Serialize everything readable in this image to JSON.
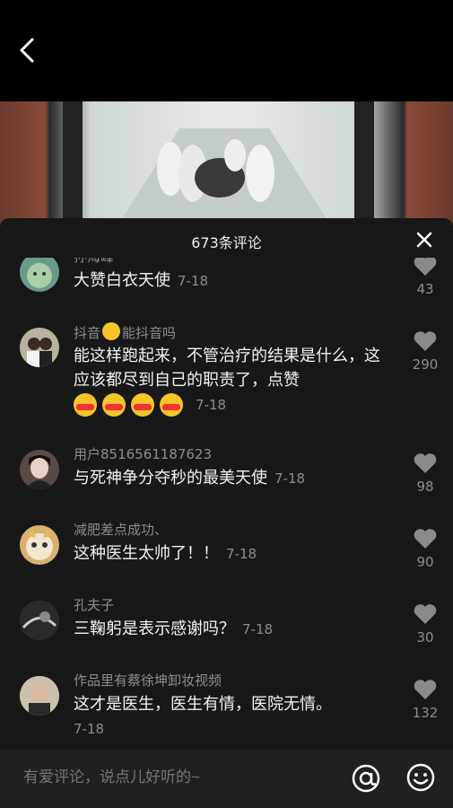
{
  "header": {
    "back_icon": "chevron-left-icon"
  },
  "sheet": {
    "title": "673条评论",
    "close_icon": "close-icon"
  },
  "comments": [
    {
      "user": "孙海峰",
      "text": "大赞白衣天使",
      "date": "7-18",
      "likes": "43",
      "avatar_color": "#6b9a8a"
    },
    {
      "user_prefix": "抖音",
      "user_suffix": "能抖音吗",
      "text": "能这样跑起来，不管治疗的结果是什么，这应该都尽到自己的职责了，点赞",
      "date": "7-18",
      "likes": "290",
      "avatar_color": "#b8b2a0"
    },
    {
      "user": "用户8516561187623",
      "text": "与死神争分夺秒的最美天使",
      "date": "7-18",
      "likes": "98",
      "avatar_color": "#5a4a46"
    },
    {
      "user": "减肥差点成功、",
      "text": "这种医生太帅了！！",
      "date": "7-18",
      "likes": "90",
      "avatar_color": "#d8b070"
    },
    {
      "user": "孔夫子",
      "text": "三鞠躬是表示感谢吗？",
      "date": "7-18",
      "likes": "30",
      "avatar_color": "#444"
    },
    {
      "user": "作品里有蔡徐坤卸妆视频",
      "text": "这才是医生，医生有情，医院无情。",
      "date": "7-18",
      "likes": "132",
      "avatar_color": "#b0a090"
    }
  ],
  "input": {
    "placeholder": "有爱评论，说点儿好听的~"
  },
  "icons": {
    "at": "at-icon",
    "emoji": "emoji-icon",
    "like": "heart-icon"
  }
}
